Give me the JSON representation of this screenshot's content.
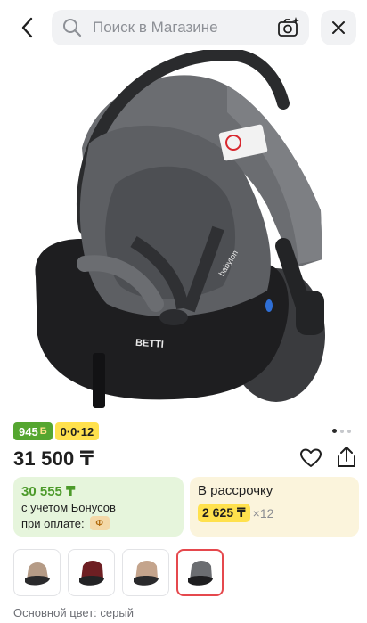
{
  "header": {
    "search_placeholder": "Поиск в Магазине",
    "icons": [
      "chevron-left-icon",
      "search-icon",
      "camera-sparkle-icon",
      "close-icon"
    ]
  },
  "product": {
    "image_text": "BETTI",
    "image_brand": "babyton",
    "badge_bonus": "945",
    "badge_bonus_symbol": "Б",
    "badge_installment": "0·0·12",
    "price": "31 500 ₸",
    "carousel_pages": 3,
    "carousel_active": 1
  },
  "bonus_card": {
    "amount": "30 555 ₸",
    "line1": "с учетом Бонусов",
    "line2": "при оплате:",
    "coin": "Ф"
  },
  "installment_card": {
    "title": "В рассрочку",
    "monthly": "2 625 ₸",
    "multiplier": "×12"
  },
  "variants": {
    "thumbnails": [
      "beige",
      "burgundy",
      "light-brown",
      "grey"
    ],
    "selected_index": 3,
    "label": "Основной цвет: серый"
  },
  "colors": {
    "bonus_green": "#55a630",
    "installment_yellow": "#ffe14d",
    "selected_border": "#e5484d",
    "seat_black": "#1e1e20",
    "seat_grey": "#5d5f63"
  }
}
